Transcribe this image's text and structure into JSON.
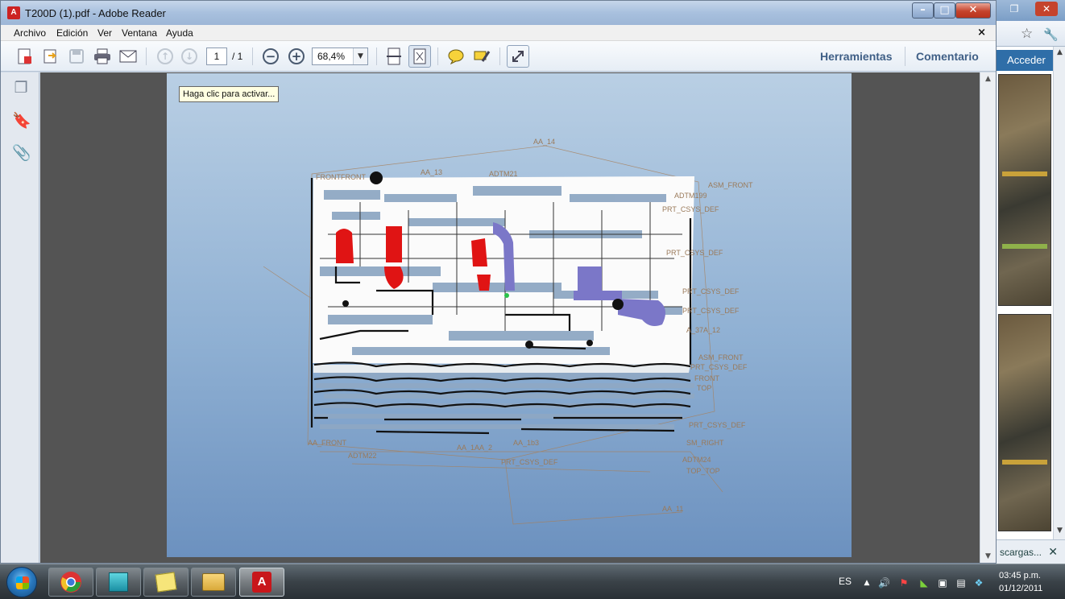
{
  "window": {
    "title": "T200D (1).pdf - Adobe Reader",
    "minimize": "–",
    "maximize": "□",
    "close": "✕"
  },
  "menu": {
    "items": [
      "Archivo",
      "Edición",
      "Ver",
      "Ventana",
      "Ayuda"
    ],
    "close": "×"
  },
  "toolbar": {
    "page_current": "1",
    "page_total": "/ 1",
    "zoom": "68,4%",
    "zoom_drop": "▼",
    "tools_label": "Herramientas",
    "comment_label": "Comentario"
  },
  "document": {
    "tooltip": "Haga clic para activar..."
  },
  "scrollbar": {
    "up": "▲",
    "down": "▼"
  },
  "background_browser": {
    "acceder": "Acceder",
    "download_text": "scargas...",
    "download_close": "✕",
    "star": "☆",
    "wrench": "🔧",
    "restore": "❐",
    "close": "✕"
  },
  "taskbar": {
    "language": "ES",
    "time": "03:45 p.m.",
    "date": "01/12/2011",
    "tray_up": "▲"
  },
  "colors": {
    "accent_text": "#3f5f86",
    "doc_background": "#545454",
    "close_red": "#c5432c"
  }
}
